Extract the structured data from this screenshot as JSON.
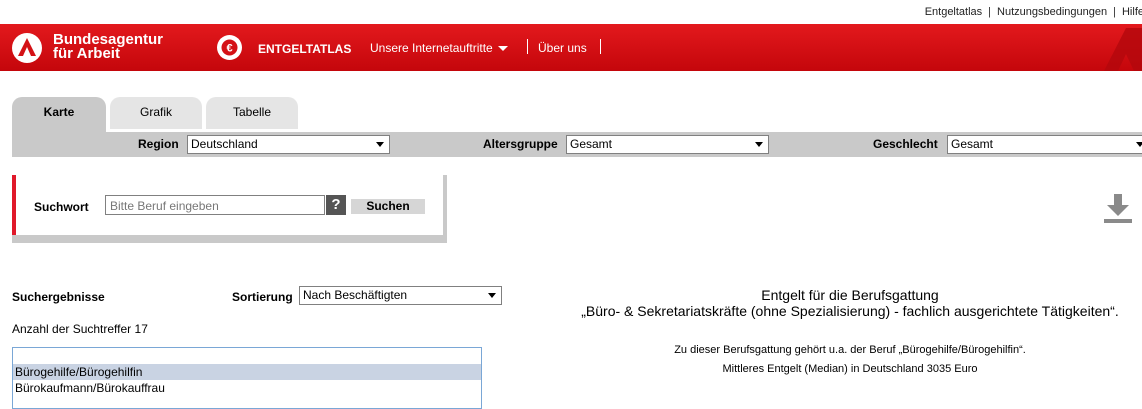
{
  "top_links": [
    "Entgeltatlas",
    "Nutzungsbedingungen",
    "Hilfe"
  ],
  "header": {
    "brand_line1": "Bundesagentur",
    "brand_line2": "für Arbeit",
    "app_label": "ENTGELTATLAS",
    "nav": [
      "Unsere Internetauftritte",
      "Über uns"
    ],
    "accent": "#e3191d"
  },
  "tabs": [
    {
      "label": "Karte",
      "active": true
    },
    {
      "label": "Grafik",
      "active": false
    },
    {
      "label": "Tabelle",
      "active": false
    }
  ],
  "filters": {
    "region_label": "Region",
    "region_value": "Deutschland",
    "age_label": "Altersgruppe",
    "age_value": "Gesamt",
    "gender_label": "Geschlecht",
    "gender_value": "Gesamt"
  },
  "search": {
    "label": "Suchwort",
    "placeholder": "Bitte Beruf eingeben",
    "help": "?",
    "button": "Suchen"
  },
  "results": {
    "title": "Suchergebnisse",
    "sort_label": "Sortierung",
    "sort_value": "Nach Beschäftigten",
    "hits_text": "Anzahl der Suchtreffer 17",
    "items": [
      "",
      "Bürogehilfe/Bürogehilfin",
      "Bürokaufmann/Bürokauffrau"
    ],
    "selected_index": 1
  },
  "info": {
    "line1": "Entgelt für die Berufsgattung",
    "line2": "„Büro- & Sekretariatskräfte (ohne Spezialisierung) - fachlich ausgerichtete Tätigkeiten“.",
    "line3": "Zu dieser Berufsgattung gehört u.a. der Beruf „Bürogehilfe/Bürogehilfin“.",
    "line4": "Mittleres Entgelt (Median) in Deutschland 3035 Euro"
  },
  "icons": [
    "ba-logo-icon",
    "entgeltatlas-icon",
    "chevron-down-icon",
    "download-icon"
  ]
}
